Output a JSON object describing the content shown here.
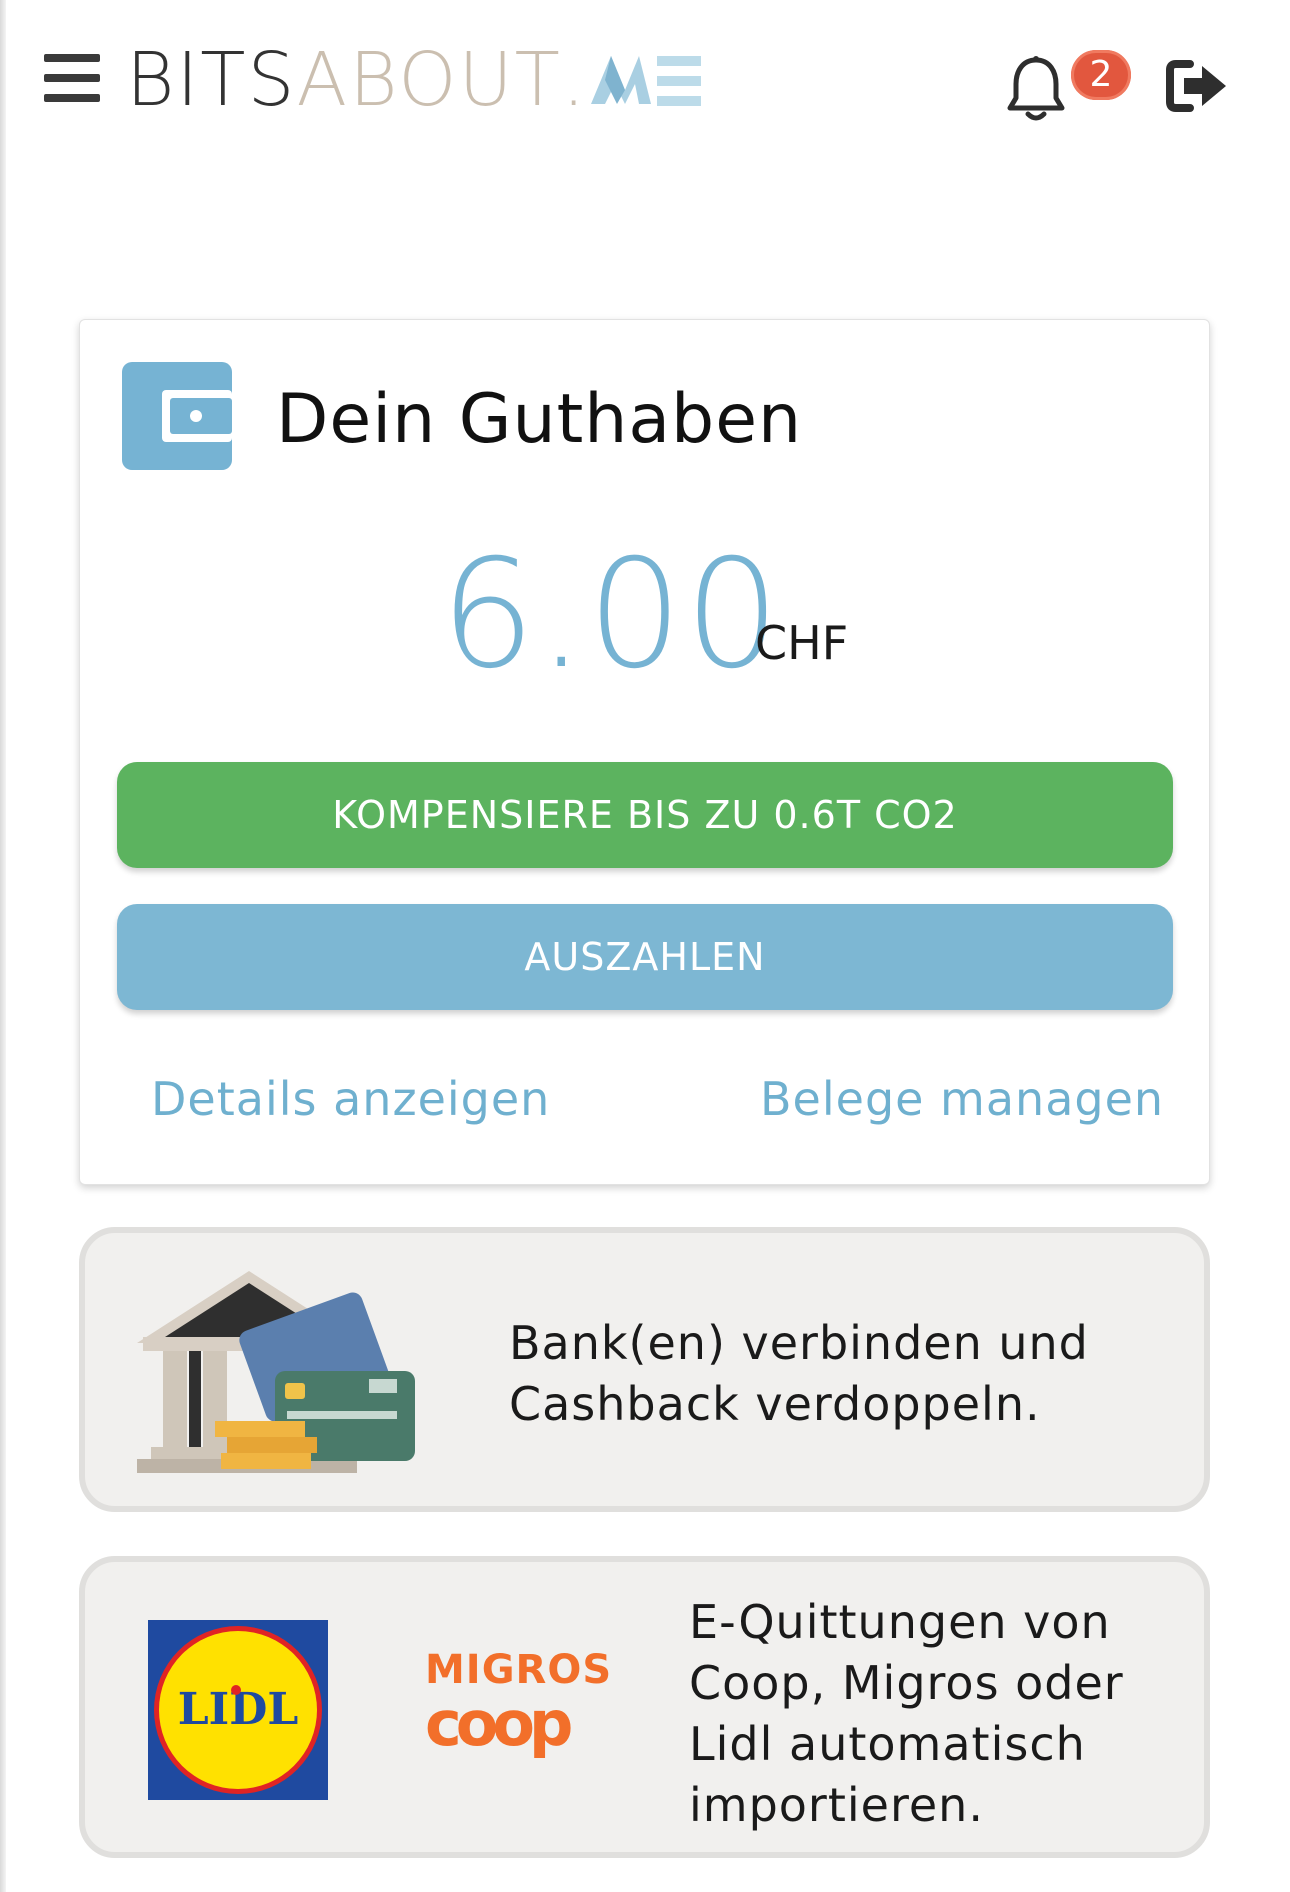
{
  "header": {
    "logo": {
      "part1": "BITS",
      "part2": "ABOUT",
      "part3": "."
    },
    "notifications": {
      "count": "2"
    }
  },
  "balance_card": {
    "title": "Dein Guthaben",
    "amount": "6.00",
    "currency": "CHF",
    "compensate_button": "KOMPENSIERE BIS ZU 0.6T CO2",
    "payout_button": "AUSZAHLEN",
    "details_link": "Details anzeigen",
    "receipts_link": "Belege managen"
  },
  "promos": {
    "bank": {
      "line1": "Bank(en) verbinden und",
      "line2": "Cashback verdoppeln."
    },
    "receipts": {
      "line1": "E-Quittungen von",
      "line2": "Coop, Migros oder",
      "line3": "Lidl automatisch",
      "line4": "importieren.",
      "migros": "MIGROS",
      "coop": "coop",
      "lidl": "LIDL"
    }
  },
  "colors": {
    "accent_blue": "#76b3d3",
    "green_button": "#5cb35f",
    "blue_button": "#7db7d3",
    "badge": "#e2573e"
  },
  "icons": [
    "menu-icon",
    "bell-icon",
    "logout-icon",
    "wallet-icon"
  ]
}
